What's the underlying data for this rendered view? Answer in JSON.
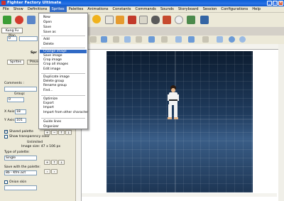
{
  "window": {
    "title": "Fighter Factory Ultimate"
  },
  "menubar": {
    "items": [
      "File",
      "Show",
      "Definitions",
      "Sprites",
      "Palettes",
      "Animations",
      "Constants",
      "Commands",
      "Sounds",
      "Storyboard",
      "Session",
      "Configurations",
      "Help"
    ],
    "active_index": 3
  },
  "sprites_menu": {
    "items": [
      "New",
      "Open",
      "Save",
      "Save as",
      "Add",
      "Delete",
      "Change image",
      "Save image",
      "Crop image",
      "Crop all images",
      "Edit image",
      "Duplicate image",
      "Delete group",
      "Rename group",
      "Find...",
      "Optimize",
      "Export",
      "Import",
      "Import from other character",
      "Guide lines",
      "Organizer"
    ],
    "selected": "Change image"
  },
  "left_panel": {
    "character_tab": "Kung Fu Man",
    "spin_value": "0",
    "section_title": "Spr",
    "sprite_tab": "Sprites",
    "preview_tab": "Preview",
    "comments_label": "Comments :",
    "group_label": "Group:",
    "group_value": "0",
    "x_axis_label": "X Axis:",
    "x_axis_value": "18",
    "y_axis_label": "Y Axis:",
    "y_axis_value": "101",
    "shared_palette_label": "Shared palette",
    "shared_palette_checked": true,
    "show_transparency_label": "Show transparency color",
    "show_transparency_checked": false,
    "image_mode": "Unlimited",
    "image_size": "Image size: 47 x 106 px",
    "palette_type_label": "Type of palette:",
    "palette_type_value": "Single",
    "save_palette_label": "Save with the palette:",
    "save_palette_value": "8b - Kfm.act",
    "onion_skin_label": "Onion skin",
    "onion_skin_checked": false
  }
}
